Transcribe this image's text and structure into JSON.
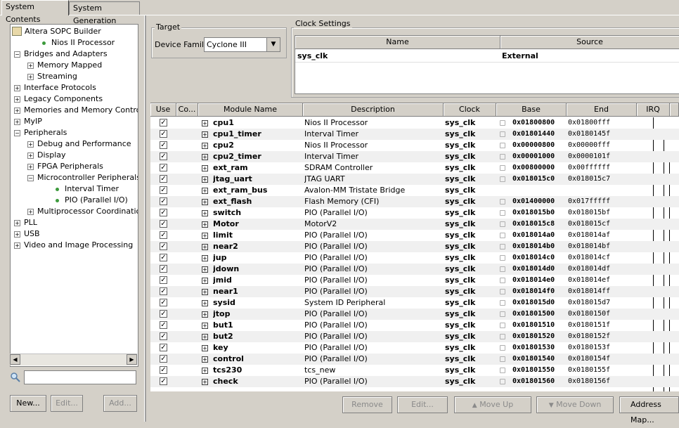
{
  "tabs": [
    {
      "label": "System Contents"
    },
    {
      "label": "System Generation"
    }
  ],
  "tree": [
    {
      "label": "Altera SOPC Builder",
      "kind": "root"
    },
    {
      "label": "Nios II Processor",
      "kind": "leaf",
      "level": 1
    },
    {
      "label": "Bridges and Adapters",
      "kind": "minus",
      "level": 0
    },
    {
      "label": "Memory Mapped",
      "kind": "plus",
      "level": 1
    },
    {
      "label": "Streaming",
      "kind": "plus",
      "level": 1
    },
    {
      "label": "Interface Protocols",
      "kind": "plus",
      "level": 0
    },
    {
      "label": "Legacy Components",
      "kind": "plus",
      "level": 0
    },
    {
      "label": "Memories and Memory Controllers",
      "kind": "plus",
      "level": 0
    },
    {
      "label": "MyIP",
      "kind": "plus",
      "level": 0
    },
    {
      "label": "Peripherals",
      "kind": "minus",
      "level": 0
    },
    {
      "label": "Debug and Performance",
      "kind": "plus",
      "level": 1
    },
    {
      "label": "Display",
      "kind": "plus",
      "level": 1
    },
    {
      "label": "FPGA Peripherals",
      "kind": "plus",
      "level": 1
    },
    {
      "label": "Microcontroller Peripherals",
      "kind": "minus",
      "level": 1
    },
    {
      "label": "Interval Timer",
      "kind": "leaf",
      "level": 2
    },
    {
      "label": "PIO (Parallel I/O)",
      "kind": "leaf",
      "level": 2
    },
    {
      "label": "Multiprocessor Coordination",
      "kind": "plus",
      "level": 1
    },
    {
      "label": "PLL",
      "kind": "plus",
      "level": 0
    },
    {
      "label": "USB",
      "kind": "plus",
      "level": 0
    },
    {
      "label": "Video and Image Processing",
      "kind": "plus",
      "level": 0
    }
  ],
  "search": {
    "value": ""
  },
  "left_buttons": {
    "new": "New...",
    "edit": "Edit...",
    "add": "Add..."
  },
  "target": {
    "group_label": "Target",
    "family_label": "Device Family:",
    "family_value": "Cyclone III"
  },
  "clock": {
    "group_label": "Clock Settings",
    "col_name": "Name",
    "col_source": "Source",
    "name": "sys_clk",
    "source": "External"
  },
  "table": {
    "headers": {
      "use": "Use",
      "conn": "Co...",
      "module": "Module Name",
      "desc": "Description",
      "clock": "Clock",
      "base": "Base",
      "end": "End",
      "irq": "IRQ"
    },
    "rows": [
      {
        "name": "cpu1",
        "desc": "Nios II Processor",
        "clock": "sys_clk",
        "base": "0x01800800",
        "end": "0x01800fff"
      },
      {
        "name": "cpu1_timer",
        "desc": "Interval Timer",
        "clock": "sys_clk",
        "base": "0x01801440",
        "end": "0x0180145f"
      },
      {
        "name": "cpu2",
        "desc": "Nios II Processor",
        "clock": "sys_clk",
        "base": "0x00000800",
        "end": "0x00000fff"
      },
      {
        "name": "cpu2_timer",
        "desc": "Interval Timer",
        "clock": "sys_clk",
        "base": "0x00001000",
        "end": "0x0000101f"
      },
      {
        "name": "ext_ram",
        "desc": "SDRAM Controller",
        "clock": "sys_clk",
        "base": "0x00800000",
        "end": "0x00ffffff"
      },
      {
        "name": "jtag_uart",
        "desc": "JTAG UART",
        "clock": "sys_clk",
        "base": "0x018015c0",
        "end": "0x018015c7"
      },
      {
        "name": "ext_ram_bus",
        "desc": "Avalon-MM Tristate Bridge",
        "clock": "sys_clk",
        "base": "",
        "end": ""
      },
      {
        "name": "ext_flash",
        "desc": "Flash Memory (CFI)",
        "clock": "sys_clk",
        "base": "0x01400000",
        "end": "0x017fffff"
      },
      {
        "name": "switch",
        "desc": "PIO (Parallel I/O)",
        "clock": "sys_clk",
        "base": "0x018015b0",
        "end": "0x018015bf"
      },
      {
        "name": "Motor",
        "desc": "MotorV2",
        "clock": "sys_clk",
        "base": "0x018015c8",
        "end": "0x018015cf"
      },
      {
        "name": "limit",
        "desc": "PIO (Parallel I/O)",
        "clock": "sys_clk",
        "base": "0x018014a0",
        "end": "0x018014af"
      },
      {
        "name": "near2",
        "desc": "PIO (Parallel I/O)",
        "clock": "sys_clk",
        "base": "0x018014b0",
        "end": "0x018014bf"
      },
      {
        "name": "jup",
        "desc": "PIO (Parallel I/O)",
        "clock": "sys_clk",
        "base": "0x018014c0",
        "end": "0x018014cf"
      },
      {
        "name": "jdown",
        "desc": "PIO (Parallel I/O)",
        "clock": "sys_clk",
        "base": "0x018014d0",
        "end": "0x018014df"
      },
      {
        "name": "jmid",
        "desc": "PIO (Parallel I/O)",
        "clock": "sys_clk",
        "base": "0x018014e0",
        "end": "0x018014ef"
      },
      {
        "name": "near1",
        "desc": "PIO (Parallel I/O)",
        "clock": "sys_clk",
        "base": "0x018014f0",
        "end": "0x018014ff"
      },
      {
        "name": "sysid",
        "desc": "System ID Peripheral",
        "clock": "sys_clk",
        "base": "0x018015d0",
        "end": "0x018015d7"
      },
      {
        "name": "jtop",
        "desc": "PIO (Parallel I/O)",
        "clock": "sys_clk",
        "base": "0x01801500",
        "end": "0x0180150f"
      },
      {
        "name": "but1",
        "desc": "PIO (Parallel I/O)",
        "clock": "sys_clk",
        "base": "0x01801510",
        "end": "0x0180151f"
      },
      {
        "name": "but2",
        "desc": "PIO (Parallel I/O)",
        "clock": "sys_clk",
        "base": "0x01801520",
        "end": "0x0180152f"
      },
      {
        "name": "key",
        "desc": "PIO (Parallel I/O)",
        "clock": "sys_clk",
        "base": "0x01801530",
        "end": "0x0180153f"
      },
      {
        "name": "control",
        "desc": "PIO (Parallel I/O)",
        "clock": "sys_clk",
        "base": "0x01801540",
        "end": "0x0180154f"
      },
      {
        "name": "tcs230",
        "desc": "tcs_new",
        "clock": "sys_clk",
        "base": "0x01801550",
        "end": "0x0180155f"
      },
      {
        "name": "check",
        "desc": "PIO (Parallel I/O)",
        "clock": "sys_clk",
        "base": "0x01801560",
        "end": "0x0180156f"
      }
    ]
  },
  "bottom_buttons": {
    "remove": "Remove",
    "edit": "Edit...",
    "move_up": "Move Up",
    "move_down": "Move Down",
    "address_map": "Address Map..."
  }
}
